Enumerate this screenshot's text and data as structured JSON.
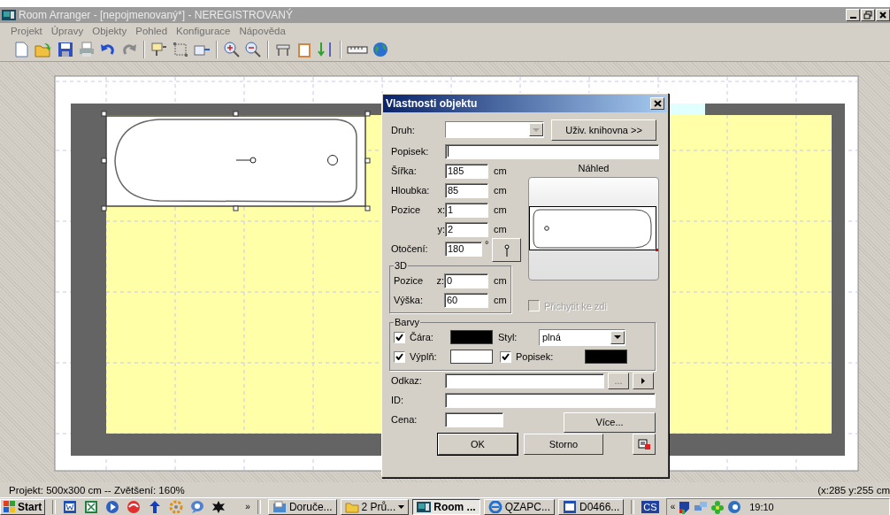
{
  "window": {
    "title": "Room Arranger - [nepojmenovaný*] - NEREGISTROVANÝ"
  },
  "menu": [
    "Projekt",
    "Úpravy",
    "Objekty",
    "Pohled",
    "Konfigurace",
    "Nápověda"
  ],
  "dialog": {
    "title": "Vlastnosti objektu",
    "type_field": {
      "label": "Druh:"
    },
    "library_button": "Uživ. knihovna >>",
    "label_field": {
      "label": "Popisek:"
    },
    "size_fields": [
      {
        "label": "Šířka:",
        "value": "185",
        "unit": "cm"
      },
      {
        "label": "Hloubka:",
        "value": "85",
        "unit": "cm"
      },
      {
        "label": "Pozice",
        "axis": "x:",
        "value": "1",
        "unit": "cm"
      },
      {
        "axis": "y:",
        "value": "2",
        "unit": "cm"
      },
      {
        "label": "Otočení:",
        "value": "180",
        "unit": "°"
      }
    ],
    "preview_label": "Náhled",
    "group_3d": {
      "title": "3D",
      "fields": [
        {
          "label": "Pozice",
          "axis": "z:",
          "value": "0",
          "unit": "cm"
        },
        {
          "label": "Výška:",
          "value": "60",
          "unit": "cm"
        }
      ]
    },
    "attach_checkbox": {
      "label": "Přichytit ke zdi",
      "checked": false,
      "disabled": true
    },
    "colors": {
      "title": "Barvy",
      "line": {
        "label": "Čára:",
        "checked": true,
        "color": "#000000"
      },
      "style": {
        "label": "Styl:",
        "value": "plná"
      },
      "fill": {
        "label": "Výplň:",
        "checked": true,
        "color": "#ffffff"
      },
      "caption": {
        "label": "Popisek:",
        "checked": true,
        "color": "#000000"
      }
    },
    "link_field": {
      "label": "Odkaz:",
      "browse": "..."
    },
    "id_field": {
      "label": "ID:"
    },
    "price_field": {
      "label": "Cena:"
    },
    "more_button": "Více...",
    "buttons": [
      "OK",
      "Storno"
    ]
  },
  "status_bar": {
    "left": "Projekt: 500x300 cm -- Zvětšení: 160%",
    "right": "(x:285 y:255 cm"
  },
  "taskbar": {
    "start": "Start",
    "overflow": "»",
    "tasks": [
      {
        "label": "Doruče...",
        "selected": false,
        "kind": "mail"
      },
      {
        "label": "2 Prů...",
        "selected": false,
        "kind": "folder"
      },
      {
        "label": "Room ...",
        "selected": true,
        "kind": "app"
      },
      {
        "label": "QZAPC...",
        "selected": false,
        "kind": "browser"
      },
      {
        "label": "D0466...",
        "selected": false,
        "kind": "word"
      }
    ],
    "language": "CS",
    "tray_toggle": "«",
    "clock": "19:10"
  }
}
